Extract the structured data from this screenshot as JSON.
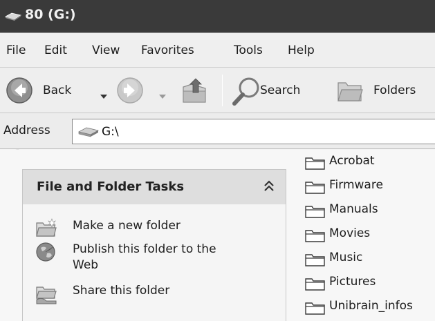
{
  "window": {
    "title": "80 (G:)"
  },
  "menu": {
    "items": [
      "File",
      "Edit",
      "View",
      "Favorites",
      "Tools",
      "Help"
    ]
  },
  "toolbar": {
    "back_label": "Back",
    "search_label": "Search",
    "folders_label": "Folders"
  },
  "address": {
    "label": "Address",
    "value": "G:\\"
  },
  "tasks": {
    "title": "File and Folder Tasks",
    "collapse_glyph": "˄",
    "items": [
      {
        "label_line1": "Make a new folder",
        "label_line2": ""
      },
      {
        "label_line1": "Publish this folder to the",
        "label_line2": "Web"
      },
      {
        "label_line1": "Share this folder",
        "label_line2": ""
      }
    ]
  },
  "files": [
    {
      "name": "Acrobat"
    },
    {
      "name": "Firmware"
    },
    {
      "name": "Manuals"
    },
    {
      "name": "Movies"
    },
    {
      "name": "Music"
    },
    {
      "name": "Pictures"
    },
    {
      "name": "Unibrain_infos"
    }
  ],
  "colors": {
    "titlebar": "#3a3a3a",
    "menubar": "#efefef",
    "panel_header": "#dedede",
    "background": "#f7f7f7"
  },
  "icons": {
    "title": "drive-icon",
    "back": "back-arrow-icon",
    "forward": "forward-arrow-icon",
    "up": "up-folder-icon",
    "search": "magnifier-icon",
    "folders": "folders-icon",
    "address": "drive-icon",
    "new_folder": "new-folder-icon",
    "publish": "globe-icon",
    "share": "share-folder-icon",
    "file": "folder-icon"
  }
}
